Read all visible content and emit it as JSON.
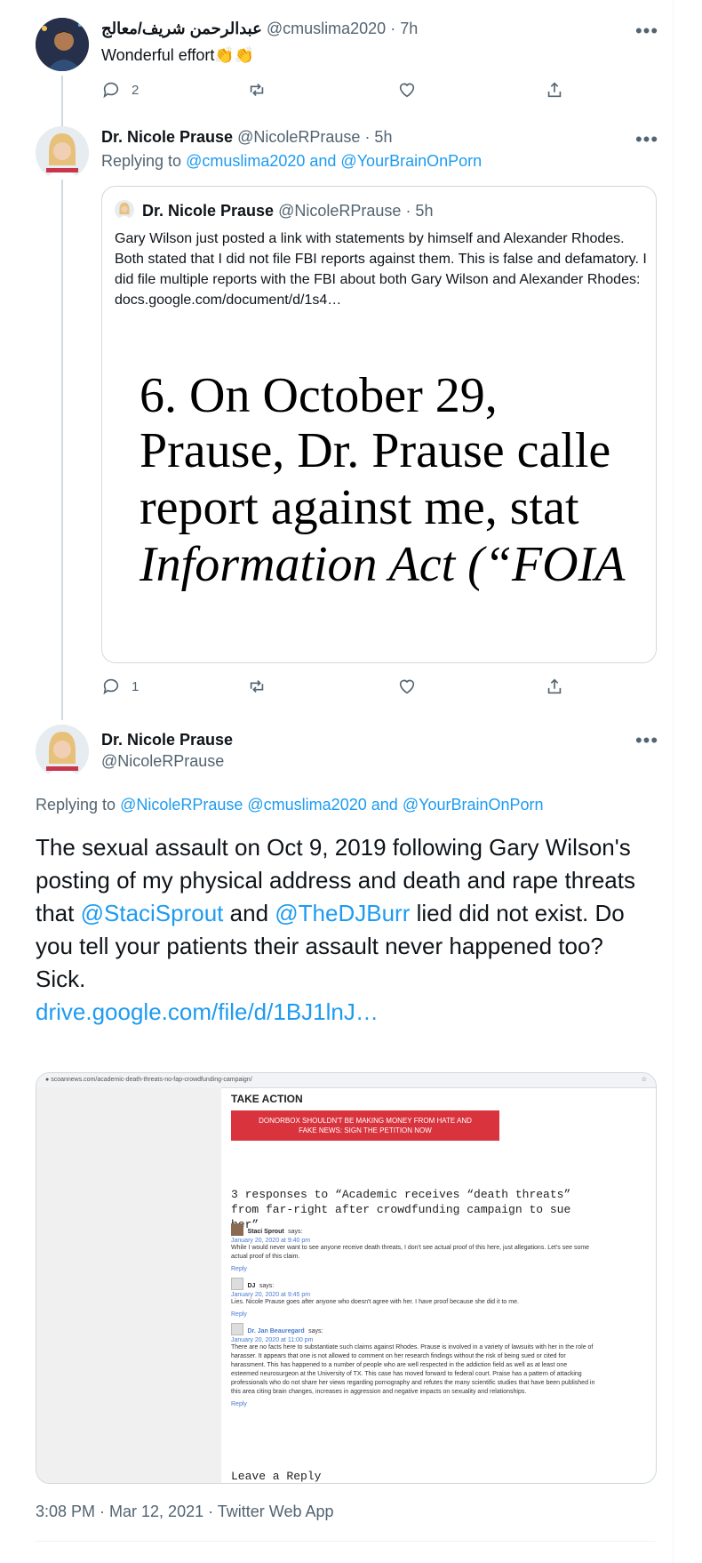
{
  "tweet1": {
    "name": "عبدالرحمن شريف/معالج",
    "handle": "@cmuslima2020",
    "time": "· 7h",
    "text": "Wonderful effort",
    "emoji": "👏👏",
    "reply_count": "2",
    "retweet_count": "",
    "like_count": ""
  },
  "tweet2": {
    "name": "Dr. Nicole Prause",
    "handle": "@NicoleRPrause",
    "time": "· 5h",
    "replying_prefix": "Replying to",
    "replying_targets": "@cmuslima2020 and @YourBrainOnPorn",
    "reply_count": "1",
    "quote": {
      "name": "Dr. Nicole Prause",
      "handle": "@NicoleRPrause",
      "time": "· 5h",
      "text": "Gary Wilson just posted a link with statements by himself and Alexander Rhodes. Both stated that I did not file FBI reports against them. This is false and defamatory. I did file multiple reports with the FBI about both Gary Wilson and Alexander Rhodes:",
      "link": "docs.google.com/document/d/1s4…",
      "image_lines": [
        "6.         On October 29,",
        "Prause, Dr. Prause calle",
        "report against me, stat",
        "Information Act (“FOIA"
      ]
    }
  },
  "tweet3": {
    "name": "Dr. Nicole Prause",
    "handle": "@NicoleRPrause",
    "replying_prefix": "Replying to",
    "replying_handles": "@NicoleRPrause @cmuslima2020",
    "replying_and": "and",
    "replying_last": "@YourBrainOnPorn",
    "text_part1": "The sexual assault on Oct 9, 2019 following Gary Wilson's posting of my physical address and death and rape threats that",
    "mention1": "@StaciSprout",
    "text_and": "and",
    "mention2": "@TheDJBurr",
    "text_part2": "lied did not exist. Do you tell your patients their assault never happened too?",
    "text_sick": "Sick.",
    "link": "drive.google.com/file/d/1BJ1lnJ…",
    "timestamp": "3:08 PM · Mar 12, 2021 · Twitter Web App",
    "media": {
      "url": "scoannews.com/academic-death-threats-no-fap-crowdfunding-campaign/",
      "take_action": "TAKE ACTION",
      "banner": "DONORBOX SHOULDN'T BE MAKING MONEY FROM HATE AND FAKE NEWS: SIGN THE PETITION NOW",
      "responses_heading": "3 responses to “Academic receives “death threats” from far-right after crowdfunding campaign to sue her”",
      "comments": [
        {
          "name": "Staci Sprout",
          "says": "says:",
          "date": "January 20, 2020 at 9:40 pm",
          "text": "While I would never want to see anyone receive death threats, I don't see actual proof of this here, just allegations. Let's see some actual proof of this claim.",
          "reply": "Reply"
        },
        {
          "name": "DJ",
          "says": "says:",
          "date": "January 20, 2020 at 9:45 pm",
          "text": "Lies. Nicole Prause goes after anyone who doesn't agree with her. I have proof because she did it to me.",
          "reply": "Reply"
        },
        {
          "name": "Dr. Jan Beauregard",
          "says": "says:",
          "date": "January 20, 2020 at 11:00 pm",
          "text": "There are no facts here to substantiate such claims against Rhodes. Prause is involved in a variety of lawsuits with her in the role of harasser. It appears that one is not allowed to comment on her research findings without the risk of being sued or cited for harassment. This has happened to a number of people who are well respected in the addiction field as well as at least one esteemed neurosurgeon at the University of TX. This case has moved forward to federal court. Praise has a pattern of attacking professionals who do not share her views regarding pornography and refutes the many scientific studies that have been published in this area citing brain changes, increases in aggression and negative impacts on sexuality and relationships.",
          "reply": "Reply"
        }
      ],
      "leave_reply": "Leave a Reply"
    }
  },
  "colors": {
    "accent": "#1d9bf0",
    "secondary_text": "#536471",
    "border": "#cfd9de"
  }
}
